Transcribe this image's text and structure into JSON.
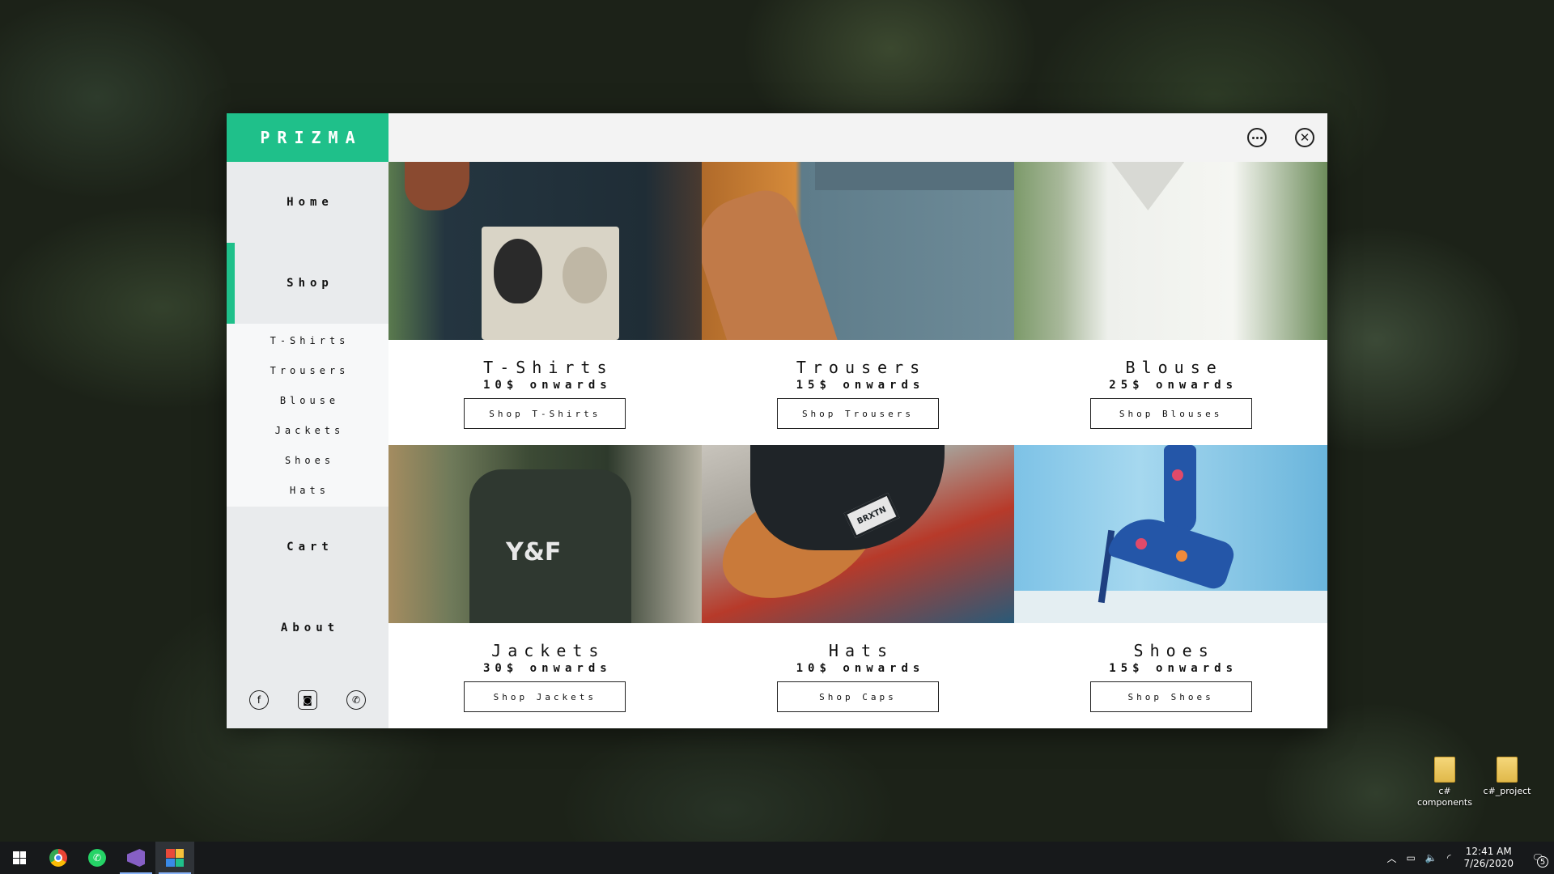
{
  "app": {
    "brand": "PRIZMA",
    "topbar": {
      "more_icon": "more-horizontal-icon",
      "close_icon": "close-icon",
      "close_glyph": "✕"
    }
  },
  "sidebar": {
    "nav": {
      "home": "Home",
      "shop": "Shop",
      "cart": "Cart",
      "about": "About"
    },
    "shop_submenu": [
      "T-Shirts",
      "Trousers",
      "Blouse",
      "Jackets",
      "Shoes",
      "Hats"
    ],
    "socials": {
      "facebook": "f",
      "instagram": "◙",
      "whatsapp": "✆"
    },
    "accent_color": "#1fc08a"
  },
  "products": [
    {
      "title": "T-Shirts",
      "price": "10$ onwards",
      "button": "Shop T-Shirts"
    },
    {
      "title": "Trousers",
      "price": "15$ onwards",
      "button": "Shop Trousers"
    },
    {
      "title": "Blouse",
      "price": "25$ onwards",
      "button": "Shop Blouses"
    },
    {
      "title": "Jackets",
      "price": "30$ onwards",
      "button": "Shop Jackets"
    },
    {
      "title": "Hats",
      "price": "10$ onwards",
      "button": "Shop Caps"
    },
    {
      "title": "Shoes",
      "price": "15$ onwards",
      "button": "Shop Shoes"
    }
  ],
  "photo_text": {
    "jacket_logo": "Y&F",
    "cap_tag": "BRXTN"
  },
  "desktop": {
    "icons": [
      {
        "label": "c# components"
      },
      {
        "label": "c#_project"
      }
    ]
  },
  "taskbar": {
    "apps": [
      "start",
      "chrome",
      "whatsapp",
      "visual-studio",
      "prizma"
    ],
    "whatsapp_glyph": "✆",
    "tray": {
      "chevron": "︿",
      "battery": "▭",
      "volume": "🔈",
      "wifi": "◜",
      "time": "12:41 AM",
      "date": "7/26/2020",
      "notification_glyph": "🗨",
      "notifications": "5"
    }
  }
}
